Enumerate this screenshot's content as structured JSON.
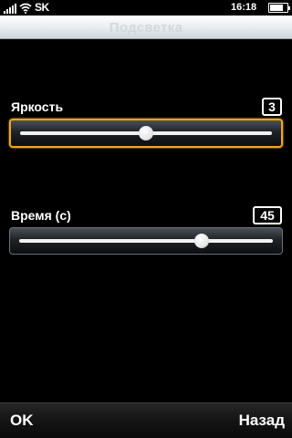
{
  "status_bar": {
    "carrier": "SK",
    "time": "16:18",
    "signal_icon": "signal-bars-icon",
    "wifi_icon": "wifi-icon",
    "battery_icon": "battery-icon",
    "battery_level": 0.8
  },
  "title_bar": {
    "title": "Подсветка"
  },
  "settings": {
    "brightness": {
      "label": "Яркость",
      "value": "3",
      "slider_fraction": 0.5
    },
    "timeout": {
      "label": "Время (с)",
      "value": "45",
      "slider_fraction": 0.72
    }
  },
  "softkeys": {
    "left": "OK",
    "right": "Назад"
  },
  "colors": {
    "focus_accent": "#f2a51c",
    "titlebar_bg": "#e9eef2",
    "background": "#000000"
  }
}
